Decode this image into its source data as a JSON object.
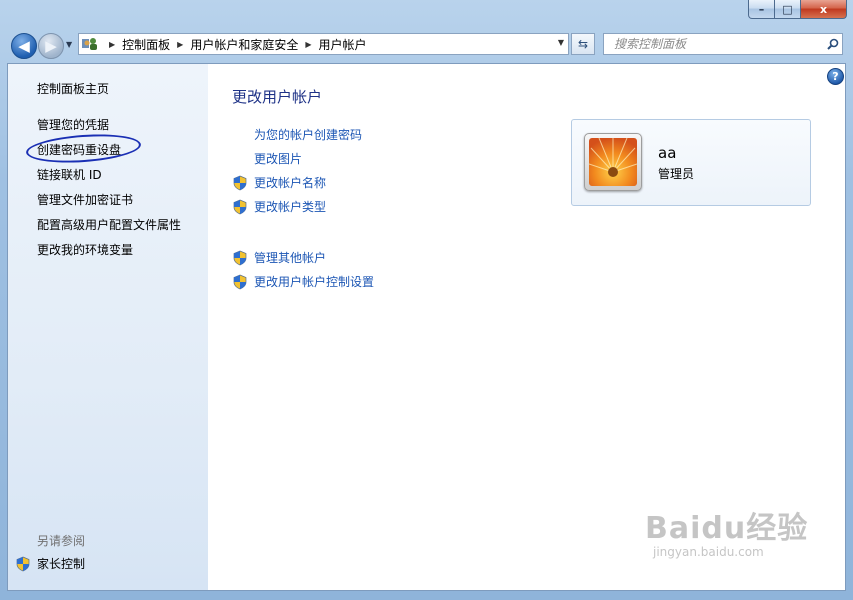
{
  "window": {
    "caption_buttons": {
      "minimize": "–",
      "maximize": "□",
      "close": "x"
    }
  },
  "navigation": {
    "back_icon": "back-arrow-icon",
    "forward_icon": "forward-arrow-icon",
    "breadcrumb": [
      "控制面板",
      "用户帐户和家庭安全",
      "用户帐户"
    ],
    "search_placeholder": "搜索控制面板"
  },
  "sidebar": {
    "items": [
      {
        "label": "控制面板主页"
      },
      {
        "label": "管理您的凭据"
      },
      {
        "label": "创建密码重设盘"
      },
      {
        "label": "链接联机 ID"
      },
      {
        "label": "管理文件加密证书"
      },
      {
        "label": "配置高级用户配置文件属性"
      },
      {
        "label": "更改我的环境变量"
      }
    ],
    "see_also_heading": "另请参阅",
    "see_also_items": [
      {
        "label": "家长控制",
        "icon": "uac-shield-icon"
      }
    ],
    "highlight_color": "#1a2fb4"
  },
  "main": {
    "title": "更改用户帐户",
    "tasks": [
      {
        "label": "为您的帐户创建密码",
        "shield": false
      },
      {
        "label": "更改图片",
        "shield": false
      },
      {
        "label": "更改帐户名称",
        "shield": true
      },
      {
        "label": "更改帐户类型",
        "shield": true
      },
      {
        "label": "管理其他帐户",
        "shield": true
      },
      {
        "label": "更改用户帐户控制设置",
        "shield": true
      }
    ],
    "user": {
      "name": "aa",
      "role": "管理员",
      "avatar_icon": "flower-avatar"
    }
  },
  "watermark": {
    "brand": "Baidu经验",
    "url": "jingyan.baidu.com"
  },
  "colors": {
    "link": "#1c56b4",
    "title": "#1e3287",
    "sidebar_bg": "#e2ecf7"
  }
}
